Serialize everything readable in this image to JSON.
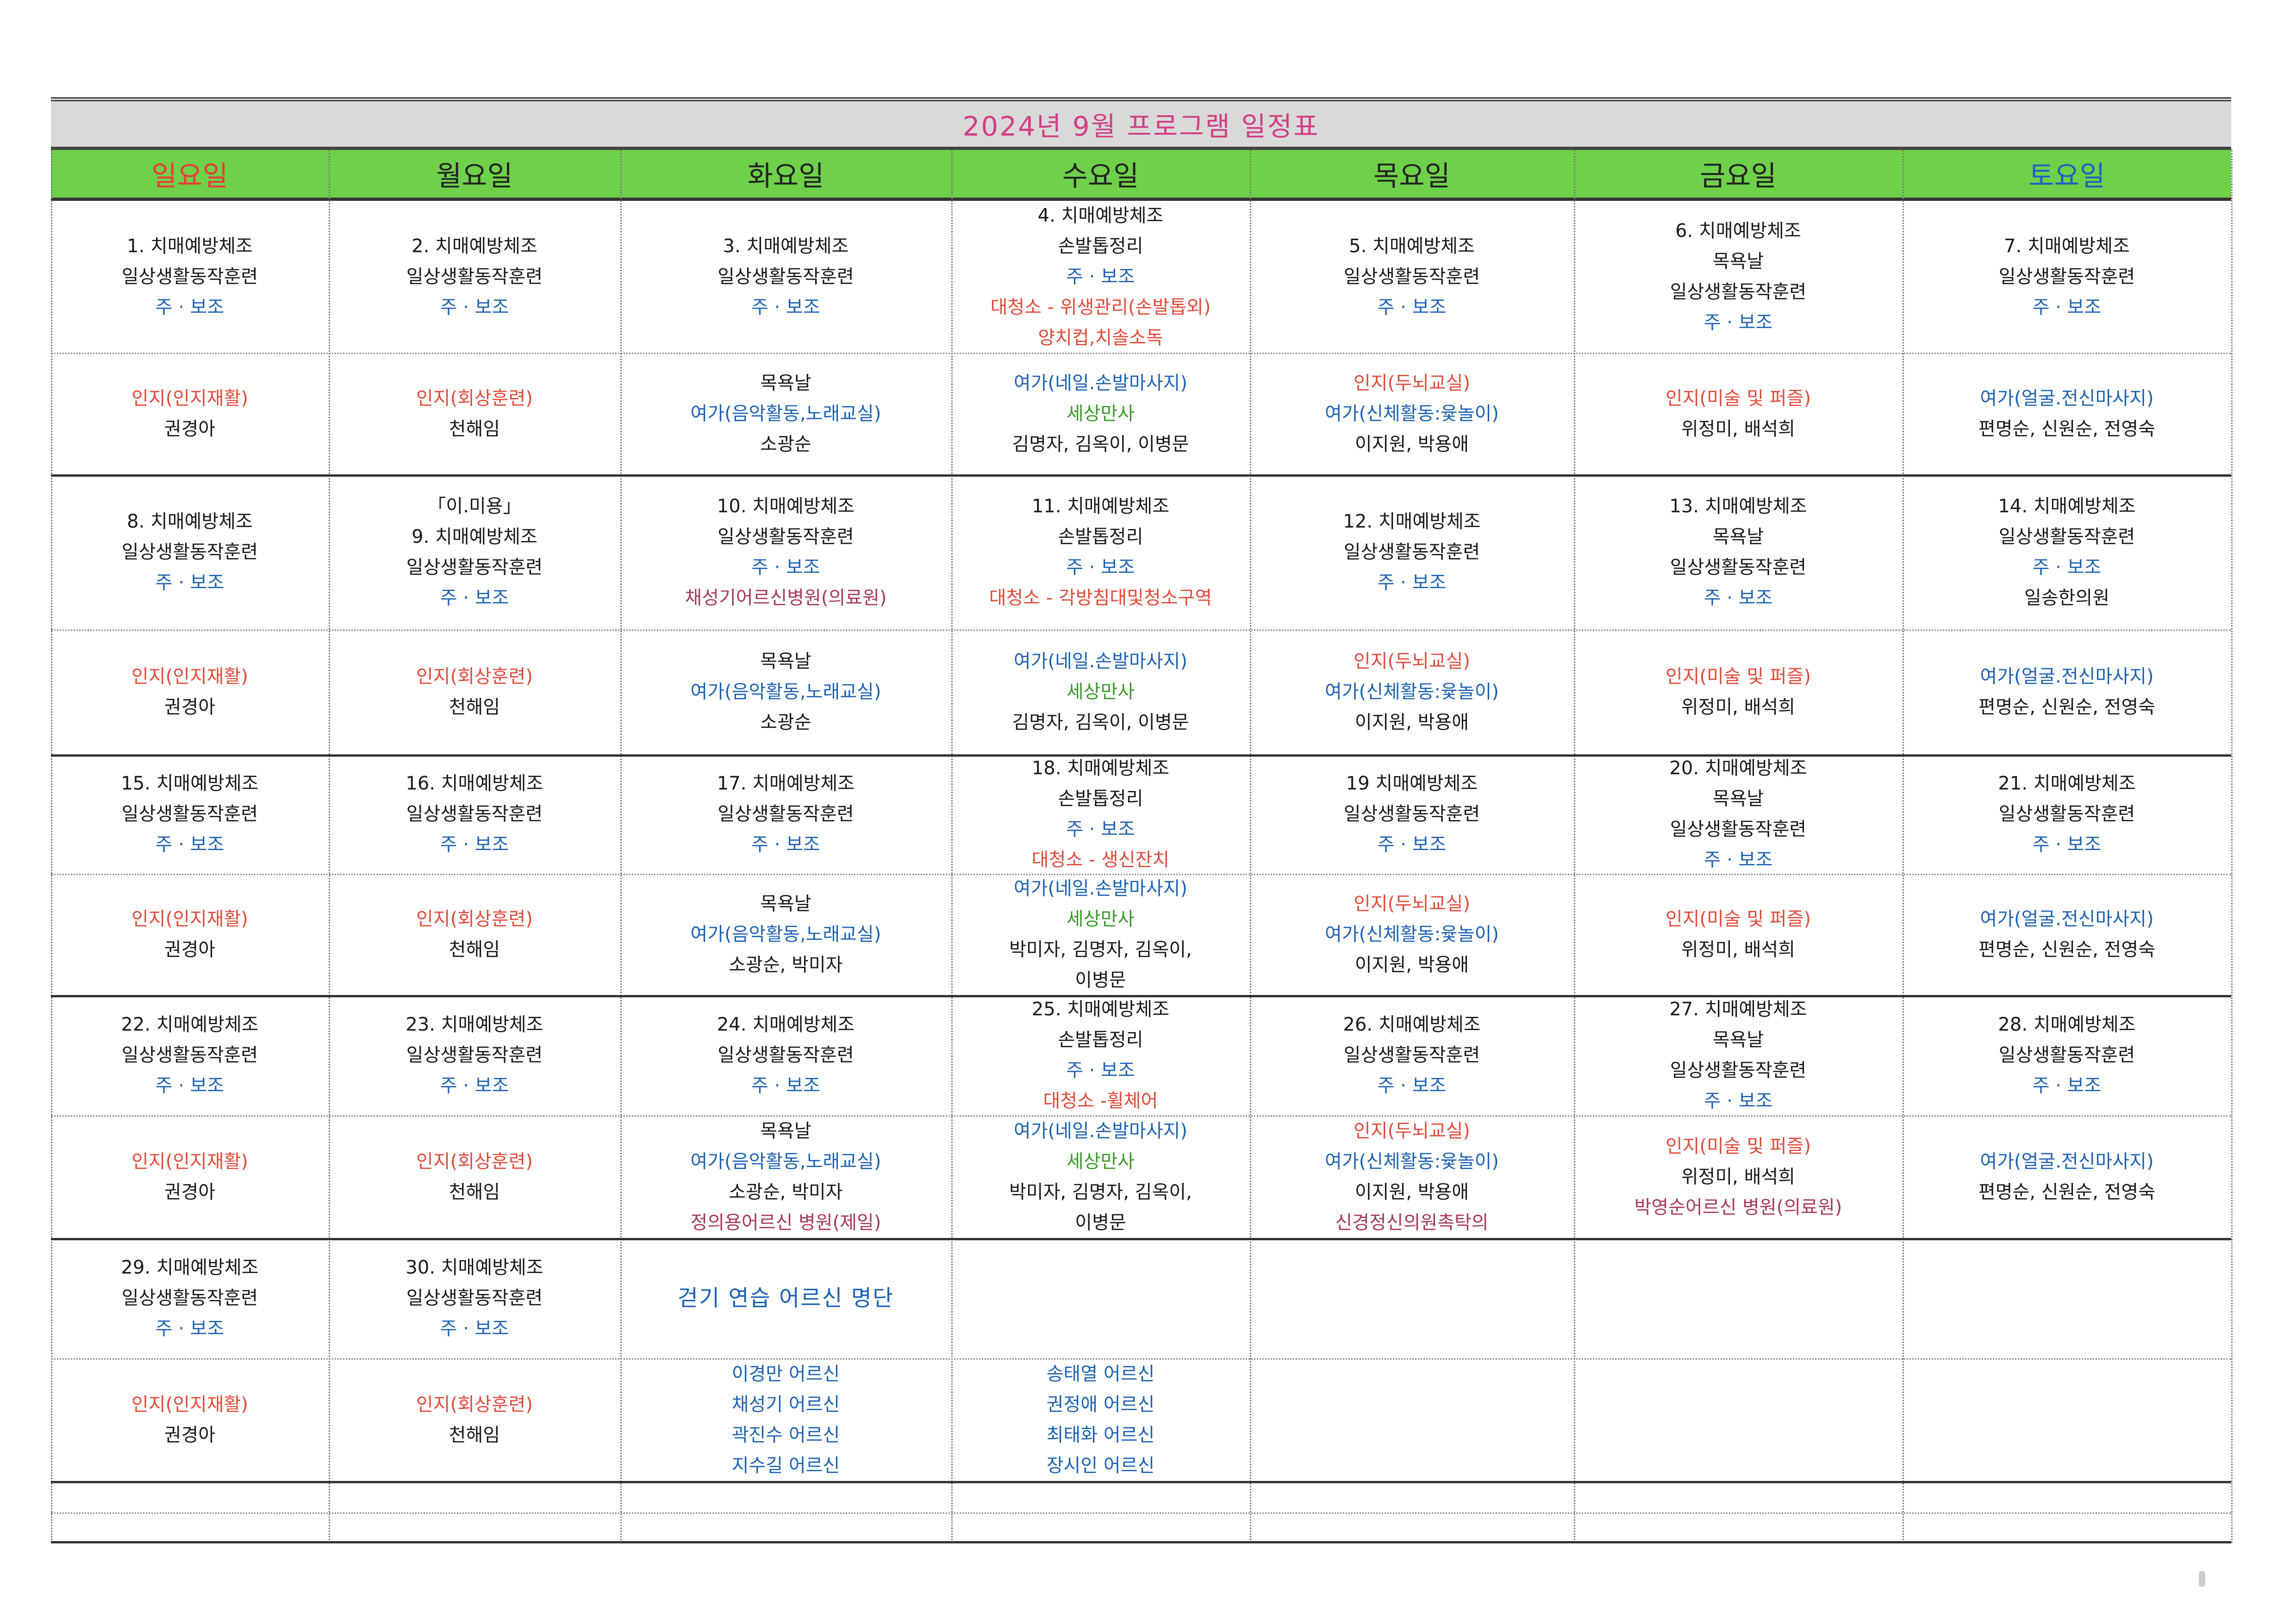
{
  "title": "2024년 9월 프로그램 일정표",
  "weekdays": [
    "일요일",
    "월요일",
    "화요일",
    "수요일",
    "목요일",
    "금요일",
    "토요일"
  ],
  "colors": {
    "title": "#d23e86",
    "header_bg": "#6fd04a",
    "sunday": "#ee3a3a",
    "saturday": "#1c64c0",
    "blue_text": "#1d62b3",
    "red_text": "#e24a3a",
    "green_text": "#3a9a2a",
    "maroon_text": "#a63a58"
  },
  "weeks": [
    {
      "top": [
        [
          {
            "t": "1. 치매예방체조",
            "c": "black"
          },
          {
            "t": "일상생활동작훈련",
            "c": "black"
          },
          {
            "t": "주 · 보조",
            "c": "blue"
          }
        ],
        [
          {
            "t": "2. 치매예방체조",
            "c": "black"
          },
          {
            "t": "일상생활동작훈련",
            "c": "black"
          },
          {
            "t": "주 · 보조",
            "c": "blue"
          }
        ],
        [
          {
            "t": "3. 치매예방체조",
            "c": "black"
          },
          {
            "t": "일상생활동작훈련",
            "c": "black"
          },
          {
            "t": "주 · 보조",
            "c": "blue"
          }
        ],
        [
          {
            "t": "4. 치매예방체조",
            "c": "black"
          },
          {
            "t": "손발톱정리",
            "c": "black"
          },
          {
            "t": "주 · 보조",
            "c": "blue"
          },
          {
            "t": "대청소 - 위생관리(손발톱외)",
            "c": "red"
          },
          {
            "t": "양치컵,치솔소독",
            "c": "red"
          }
        ],
        [
          {
            "t": "5. 치매예방체조",
            "c": "black"
          },
          {
            "t": "일상생활동작훈련",
            "c": "black"
          },
          {
            "t": "주 · 보조",
            "c": "blue"
          }
        ],
        [
          {
            "t": "6. 치매예방체조",
            "c": "black"
          },
          {
            "t": "목욕날",
            "c": "black"
          },
          {
            "t": "일상생활동작훈련",
            "c": "black"
          },
          {
            "t": "주 · 보조",
            "c": "blue"
          }
        ],
        [
          {
            "t": "7. 치매예방체조",
            "c": "black"
          },
          {
            "t": "일상생활동작훈련",
            "c": "black"
          },
          {
            "t": "주 · 보조",
            "c": "blue"
          }
        ]
      ],
      "bottom": [
        [
          {
            "t": "인지(인지재활)",
            "c": "red"
          },
          {
            "t": "권경아",
            "c": "black"
          }
        ],
        [
          {
            "t": "인지(회상훈련)",
            "c": "red"
          },
          {
            "t": "천해임",
            "c": "black"
          }
        ],
        [
          {
            "t": "목욕날",
            "c": "black"
          },
          {
            "t": "여가(음악활동,노래교실)",
            "c": "blue"
          },
          {
            "t": "소광순",
            "c": "black"
          }
        ],
        [
          {
            "t": "여가(네일.손발마사지)",
            "c": "blue"
          },
          {
            "t": "세상만사",
            "c": "green"
          },
          {
            "t": "김명자, 김옥이, 이병문",
            "c": "black"
          }
        ],
        [
          {
            "t": "인지(두뇌교실)",
            "c": "red"
          },
          {
            "t": "여가(신체활동:윷놀이)",
            "c": "blue"
          },
          {
            "t": "이지원, 박용애",
            "c": "black"
          }
        ],
        [
          {
            "t": "인지(미술 및 퍼즐)",
            "c": "red"
          },
          {
            "t": "위정미, 배석희",
            "c": "black"
          }
        ],
        [
          {
            "t": "여가(얼굴.전신마사지)",
            "c": "blue"
          },
          {
            "t": "편명순, 신원순, 전영숙",
            "c": "black"
          }
        ]
      ]
    },
    {
      "top": [
        [
          {
            "t": "8. 치매예방체조",
            "c": "black"
          },
          {
            "t": "일상생활동작훈련",
            "c": "black"
          },
          {
            "t": "주 · 보조",
            "c": "blue"
          }
        ],
        [
          {
            "t": "「이.미용」",
            "c": "black"
          },
          {
            "t": "9. 치매예방체조",
            "c": "black"
          },
          {
            "t": "일상생활동작훈련",
            "c": "black"
          },
          {
            "t": "주 · 보조",
            "c": "blue"
          }
        ],
        [
          {
            "t": "10. 치매예방체조",
            "c": "black"
          },
          {
            "t": "일상생활동작훈련",
            "c": "black"
          },
          {
            "t": "주 · 보조",
            "c": "blue"
          },
          {
            "t": "채성기어르신병원(의료원)",
            "c": "maroon"
          }
        ],
        [
          {
            "t": "11. 치매예방체조",
            "c": "black"
          },
          {
            "t": "손발톱정리",
            "c": "black"
          },
          {
            "t": "주 · 보조",
            "c": "blue"
          },
          {
            "t": "대청소 - 각방침대및청소구역",
            "c": "red"
          }
        ],
        [
          {
            "t": "12. 치매예방체조",
            "c": "black"
          },
          {
            "t": "일상생활동작훈련",
            "c": "black"
          },
          {
            "t": "주 · 보조",
            "c": "blue"
          }
        ],
        [
          {
            "t": "13. 치매예방체조",
            "c": "black"
          },
          {
            "t": "목욕날",
            "c": "black"
          },
          {
            "t": "일상생활동작훈련",
            "c": "black"
          },
          {
            "t": "주 · 보조",
            "c": "blue"
          }
        ],
        [
          {
            "t": "14. 치매예방체조",
            "c": "black"
          },
          {
            "t": "일상생활동작훈련",
            "c": "black"
          },
          {
            "t": "주 · 보조",
            "c": "blue"
          },
          {
            "t": "일송한의원",
            "c": "black"
          }
        ]
      ],
      "bottom": [
        [
          {
            "t": "인지(인지재활)",
            "c": "red"
          },
          {
            "t": "권경아",
            "c": "black"
          }
        ],
        [
          {
            "t": "인지(회상훈련)",
            "c": "red"
          },
          {
            "t": "천해임",
            "c": "black"
          }
        ],
        [
          {
            "t": "목욕날",
            "c": "black"
          },
          {
            "t": "여가(음악활동,노래교실)",
            "c": "blue"
          },
          {
            "t": "소광순",
            "c": "black"
          }
        ],
        [
          {
            "t": "여가(네일.손발마사지)",
            "c": "blue"
          },
          {
            "t": "세상만사",
            "c": "green"
          },
          {
            "t": "김명자, 김옥이, 이병문",
            "c": "black"
          }
        ],
        [
          {
            "t": "인지(두뇌교실)",
            "c": "red"
          },
          {
            "t": "여가(신체활동:윷놀이)",
            "c": "blue"
          },
          {
            "t": "이지원, 박용애",
            "c": "black"
          }
        ],
        [
          {
            "t": "인지(미술 및 퍼즐)",
            "c": "red"
          },
          {
            "t": "위정미, 배석희",
            "c": "black"
          }
        ],
        [
          {
            "t": "여가(얼굴.전신마사지)",
            "c": "blue"
          },
          {
            "t": "편명순, 신원순, 전영숙",
            "c": "black"
          }
        ]
      ]
    },
    {
      "top": [
        [
          {
            "t": "15. 치매예방체조",
            "c": "black"
          },
          {
            "t": "일상생활동작훈련",
            "c": "black"
          },
          {
            "t": "주 · 보조",
            "c": "blue"
          }
        ],
        [
          {
            "t": "16. 치매예방체조",
            "c": "black"
          },
          {
            "t": "일상생활동작훈련",
            "c": "black"
          },
          {
            "t": "주 · 보조",
            "c": "blue"
          }
        ],
        [
          {
            "t": "17. 치매예방체조",
            "c": "black"
          },
          {
            "t": "일상생활동작훈련",
            "c": "black"
          },
          {
            "t": "주 · 보조",
            "c": "blue"
          }
        ],
        [
          {
            "t": "18. 치매예방체조",
            "c": "black"
          },
          {
            "t": "손발톱정리",
            "c": "black"
          },
          {
            "t": "주 · 보조",
            "c": "blue"
          },
          {
            "t": "대청소 - 생신잔치",
            "c": "red"
          }
        ],
        [
          {
            "t": "19 치매예방체조",
            "c": "black"
          },
          {
            "t": "일상생활동작훈련",
            "c": "black"
          },
          {
            "t": "주 · 보조",
            "c": "blue"
          }
        ],
        [
          {
            "t": "20. 치매예방체조",
            "c": "black"
          },
          {
            "t": "목욕날",
            "c": "black"
          },
          {
            "t": "일상생활동작훈련",
            "c": "black"
          },
          {
            "t": "주 · 보조",
            "c": "blue"
          }
        ],
        [
          {
            "t": "21. 치매예방체조",
            "c": "black"
          },
          {
            "t": "일상생활동작훈련",
            "c": "black"
          },
          {
            "t": "주 · 보조",
            "c": "blue"
          }
        ]
      ],
      "bottom": [
        [
          {
            "t": "인지(인지재활)",
            "c": "red"
          },
          {
            "t": "권경아",
            "c": "black"
          }
        ],
        [
          {
            "t": "인지(회상훈련)",
            "c": "red"
          },
          {
            "t": "천해임",
            "c": "black"
          }
        ],
        [
          {
            "t": "목욕날",
            "c": "black"
          },
          {
            "t": "여가(음악활동,노래교실)",
            "c": "blue"
          },
          {
            "t": "소광순, 박미자",
            "c": "black"
          }
        ],
        [
          {
            "t": "여가(네일.손발마사지)",
            "c": "blue"
          },
          {
            "t": "세상만사",
            "c": "green"
          },
          {
            "t": "박미자, 김명자, 김옥이,",
            "c": "black"
          },
          {
            "t": "이병문",
            "c": "black"
          }
        ],
        [
          {
            "t": "인지(두뇌교실)",
            "c": "red"
          },
          {
            "t": "여가(신체활동:윷놀이)",
            "c": "blue"
          },
          {
            "t": "이지원, 박용애",
            "c": "black"
          }
        ],
        [
          {
            "t": "인지(미술 및 퍼즐)",
            "c": "red"
          },
          {
            "t": "위정미, 배석희",
            "c": "black"
          }
        ],
        [
          {
            "t": "여가(얼굴.전신마사지)",
            "c": "blue"
          },
          {
            "t": "편명순, 신원순, 전영숙",
            "c": "black"
          }
        ]
      ]
    },
    {
      "top": [
        [
          {
            "t": "22. 치매예방체조",
            "c": "black"
          },
          {
            "t": "일상생활동작훈련",
            "c": "black"
          },
          {
            "t": "주 · 보조",
            "c": "blue"
          }
        ],
        [
          {
            "t": "23. 치매예방체조",
            "c": "black"
          },
          {
            "t": "일상생활동작훈련",
            "c": "black"
          },
          {
            "t": "주 · 보조",
            "c": "blue"
          }
        ],
        [
          {
            "t": "24. 치매예방체조",
            "c": "black"
          },
          {
            "t": "일상생활동작훈련",
            "c": "black"
          },
          {
            "t": "주 · 보조",
            "c": "blue"
          }
        ],
        [
          {
            "t": "25. 치매예방체조",
            "c": "black"
          },
          {
            "t": "손발톱정리",
            "c": "black"
          },
          {
            "t": "주 · 보조",
            "c": "blue"
          },
          {
            "t": "대청소 -휠체어",
            "c": "red"
          }
        ],
        [
          {
            "t": "26. 치매예방체조",
            "c": "black"
          },
          {
            "t": "일상생활동작훈련",
            "c": "black"
          },
          {
            "t": "주 · 보조",
            "c": "blue"
          }
        ],
        [
          {
            "t": "27. 치매예방체조",
            "c": "black"
          },
          {
            "t": "목욕날",
            "c": "black"
          },
          {
            "t": "일상생활동작훈련",
            "c": "black"
          },
          {
            "t": "주 · 보조",
            "c": "blue"
          }
        ],
        [
          {
            "t": "28. 치매예방체조",
            "c": "black"
          },
          {
            "t": "일상생활동작훈련",
            "c": "black"
          },
          {
            "t": "주 · 보조",
            "c": "blue"
          }
        ]
      ],
      "bottom": [
        [
          {
            "t": "인지(인지재활)",
            "c": "red"
          },
          {
            "t": "권경아",
            "c": "black"
          }
        ],
        [
          {
            "t": "인지(회상훈련)",
            "c": "red"
          },
          {
            "t": "천해임",
            "c": "black"
          }
        ],
        [
          {
            "t": "목욕날",
            "c": "black"
          },
          {
            "t": "여가(음악활동,노래교실)",
            "c": "blue"
          },
          {
            "t": "소광순, 박미자",
            "c": "black"
          },
          {
            "t": "정의용어르신 병원(제일)",
            "c": "maroon"
          }
        ],
        [
          {
            "t": "여가(네일.손발마사지)",
            "c": "blue"
          },
          {
            "t": "세상만사",
            "c": "green"
          },
          {
            "t": "박미자, 김명자, 김옥이,",
            "c": "black"
          },
          {
            "t": "이병문",
            "c": "black"
          }
        ],
        [
          {
            "t": "인지(두뇌교실)",
            "c": "red"
          },
          {
            "t": "여가(신체활동:윷놀이)",
            "c": "blue"
          },
          {
            "t": "이지원, 박용애",
            "c": "black"
          },
          {
            "t": "신경정신의원촉탁의",
            "c": "maroon"
          }
        ],
        [
          {
            "t": "인지(미술 및 퍼즐)",
            "c": "red"
          },
          {
            "t": "위정미, 배석희",
            "c": "black"
          },
          {
            "t": "박영순어르신 병원(의료원)",
            "c": "maroon"
          }
        ],
        [
          {
            "t": "여가(얼굴.전신마사지)",
            "c": "blue"
          },
          {
            "t": "편명순, 신원순, 전영숙",
            "c": "black"
          }
        ]
      ]
    },
    {
      "top": [
        [
          {
            "t": "29. 치매예방체조",
            "c": "black"
          },
          {
            "t": "일상생활동작훈련",
            "c": "black"
          },
          {
            "t": "주 · 보조",
            "c": "blue"
          }
        ],
        [
          {
            "t": "30. 치매예방체조",
            "c": "black"
          },
          {
            "t": "일상생활동작훈련",
            "c": "black"
          },
          {
            "t": "주 · 보조",
            "c": "blue"
          }
        ],
        [
          {
            "t": "걷기 연습 어르신 명단",
            "c": "blue",
            "big": true
          }
        ],
        [],
        [],
        [],
        []
      ],
      "bottom": [
        [
          {
            "t": "인지(인지재활)",
            "c": "red"
          },
          {
            "t": "권경아",
            "c": "black"
          }
        ],
        [
          {
            "t": "인지(회상훈련)",
            "c": "red"
          },
          {
            "t": "천해임",
            "c": "black"
          }
        ],
        [
          {
            "t": "이경만 어르신",
            "c": "blue"
          },
          {
            "t": "채성기 어르신",
            "c": "blue"
          },
          {
            "t": "곽진수 어르신",
            "c": "blue"
          },
          {
            "t": "지수길 어르신",
            "c": "blue"
          }
        ],
        [
          {
            "t": "송태열 어르신",
            "c": "blue"
          },
          {
            "t": "권정애 어르신",
            "c": "blue"
          },
          {
            "t": "최태화 어르신",
            "c": "blue"
          },
          {
            "t": "장시인 어르신",
            "c": "blue"
          }
        ],
        [],
        [],
        []
      ]
    }
  ]
}
